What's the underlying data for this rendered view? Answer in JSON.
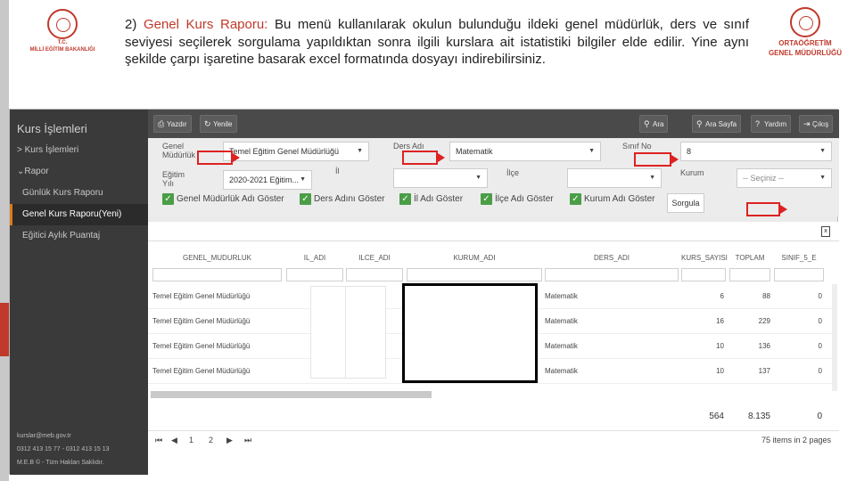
{
  "description": {
    "number": "2)",
    "title": "Genel Kurs Raporu:",
    "text": " Bu menü kullanılarak okulun bulunduğu ildeki genel müdürlük, ders ve sınıf seviyesi seçilerek sorgulama yapıldıktan sonra ilgili kurslara ait istatistiki bilgiler elde edilir. Yine aynı şekilde çarpı işaretine basarak excel formatında dosyayı indirebilirsiniz."
  },
  "logo_left": {
    "line1": "T.C.",
    "line2": "MİLLİ EĞİTİM BAKANLIĞI"
  },
  "logo_right": {
    "line1": "ORTAÖĞRETİM",
    "line2": "GENEL MÜDÜRLÜĞÜ"
  },
  "sidebar": {
    "title": "Kurs İşlemleri",
    "items": [
      {
        "label": "> Kurs İşlemleri"
      },
      {
        "label": "⌄Rapor"
      },
      {
        "label": "Günlük Kurs Raporu"
      },
      {
        "label": "Genel Kurs Raporu(Yeni)"
      },
      {
        "label": "Eğitici Aylık Puantaj"
      }
    ],
    "footer": {
      "email": "kurslar@meb.gov.tr",
      "phone": "0312 413 15 77 - 0312 413 15 13",
      "copyright": "M.E.B © - Tüm Hakları Saklıdır."
    }
  },
  "toolbar": {
    "print": "Yazdır",
    "refresh": "Yenile",
    "search": "Ara",
    "search_page": "Ara Sayfa",
    "help": "Yardım",
    "exit": "Çıkış"
  },
  "filters": {
    "genel_mudurluk": {
      "label": "Genel Müdürlük",
      "value": "Temel Eğitim Genel Müdürlüğü"
    },
    "ders_adi": {
      "label": "Ders Adı",
      "value": "Matematik"
    },
    "sinif_no": {
      "label": "Sınıf No",
      "value": "8"
    },
    "egitim_yili": {
      "label": "Eğitim Yılı",
      "value": "2020-2021 Eğitim..."
    },
    "il": {
      "label": "İl",
      "value": ""
    },
    "ilce": {
      "label": "İlçe",
      "value": ""
    },
    "kurum": {
      "label": "Kurum",
      "value": "-- Seçiniz --"
    },
    "checks": [
      {
        "label": "Genel Müdürlük Adı Göster"
      },
      {
        "label": "Ders Adını Göster"
      },
      {
        "label": "İl Adı Göster"
      },
      {
        "label": "İlçe Adı Göster"
      },
      {
        "label": "Kurum Adı Göster"
      }
    ],
    "query_button": "Sorgula"
  },
  "grid": {
    "columns": [
      "GENEL_MUDURLUK",
      "IL_ADI",
      "ILCE_ADI",
      "KURUM_ADI",
      "DERS_ADI",
      "KURS_SAYISI",
      "TOPLAM",
      "SINIF_5_E"
    ],
    "rows": [
      {
        "genel": "Temel Eğitim Genel Müdürlüğü",
        "ders": "Matematik",
        "kurs": "6",
        "toplam": "88",
        "sinif": "0"
      },
      {
        "genel": "Temel Eğitim Genel Müdürlüğü",
        "ders": "Matematik",
        "kurs": "16",
        "toplam": "229",
        "sinif": "0"
      },
      {
        "genel": "Temel Eğitim Genel Müdürlüğü",
        "ders": "Matematik",
        "kurs": "10",
        "toplam": "136",
        "sinif": "0"
      },
      {
        "genel": "Temel Eğitim Genel Müdürlüğü",
        "ders": "Matematik",
        "kurs": "10",
        "toplam": "137",
        "sinif": "0"
      }
    ],
    "totals": {
      "kurs": "564",
      "toplam": "8.135",
      "sinif": "0"
    },
    "pager": {
      "first": "⏮",
      "prev": "◀",
      "page1": "1",
      "page2": "2",
      "next": "▶",
      "last": "⏭",
      "summary": "75 items in 2 pages"
    }
  }
}
